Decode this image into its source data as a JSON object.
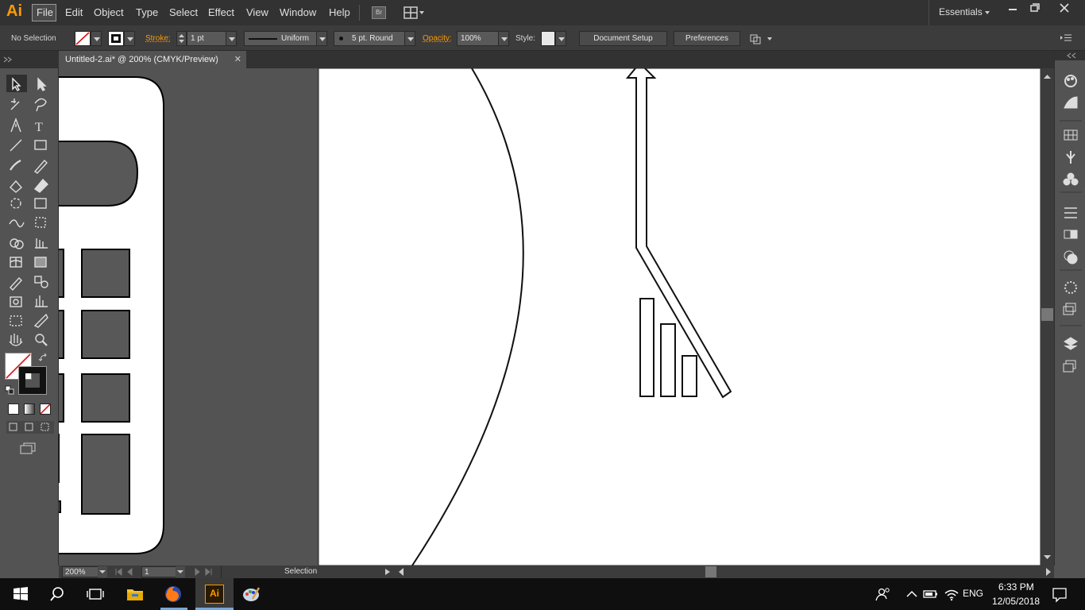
{
  "app": {
    "logo": "Ai"
  },
  "menu": [
    "File",
    "Edit",
    "Object",
    "Type",
    "Select",
    "Effect",
    "View",
    "Window",
    "Help"
  ],
  "bridge_label": "Br",
  "workspace": "Essentials",
  "control": {
    "selection": "No Selection",
    "stroke_label": "Stroke:",
    "stroke_weight": "1 pt",
    "profile": "Uniform",
    "brush": "5 pt. Round",
    "opacity_label": "Opacity:",
    "opacity": "100%",
    "style_label": "Style:",
    "document_setup": "Document Setup",
    "preferences": "Preferences"
  },
  "document": {
    "tab_title": "Untitled-2.ai* @ 200% (CMYK/Preview)"
  },
  "status": {
    "zoom": "200%",
    "artboard": "1",
    "tool": "Selection"
  },
  "taskbar": {
    "language": "ENG",
    "time": "6:33 PM",
    "date": "12/05/2018"
  },
  "colors": {
    "accent": "#ff9a00",
    "panel": "#535353",
    "bar": "#323232",
    "taskbar": "#0f0f0f"
  }
}
